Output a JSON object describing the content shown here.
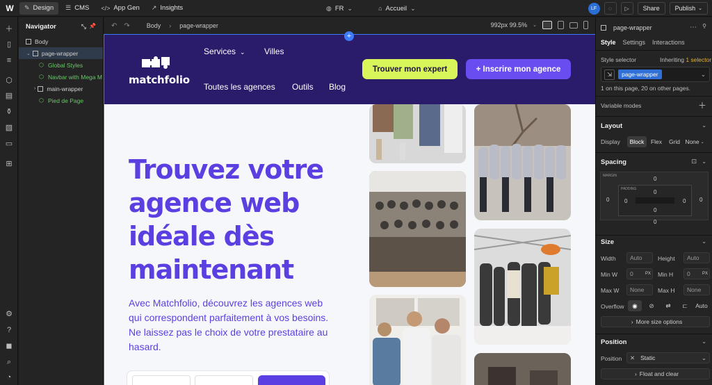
{
  "topbar": {
    "logo": "W",
    "modes": [
      {
        "label": "Design",
        "icon": "pencil-icon",
        "active": true
      },
      {
        "label": "CMS",
        "icon": "database-icon",
        "active": false
      },
      {
        "label": "App Gen",
        "icon": "code-icon",
        "active": false
      },
      {
        "label": "Insights",
        "icon": "chart-icon",
        "active": false
      }
    ],
    "locale": "FR",
    "page": "Accueil",
    "avatar": "LF",
    "share_label": "Share",
    "publish_label": "Publish"
  },
  "navigator": {
    "title": "Navigator",
    "tree": [
      {
        "label": "Body",
        "indent": 0,
        "kind": "box"
      },
      {
        "label": "page-wrapper",
        "indent": 1,
        "kind": "box",
        "selected": true
      },
      {
        "label": "Global Styles",
        "indent": 2,
        "kind": "component"
      },
      {
        "label": "Navbar with Mega M",
        "indent": 2,
        "kind": "component"
      },
      {
        "label": "main-wrapper",
        "indent": 2,
        "kind": "box"
      },
      {
        "label": "Pied de Page",
        "indent": 2,
        "kind": "component"
      }
    ]
  },
  "canvas_bar": {
    "breadcrumb": [
      "Body",
      "page-wrapper"
    ],
    "breakpoint": "992px 99.5%"
  },
  "site": {
    "brand": "matchfolio",
    "nav": {
      "services": "Services",
      "villes": "Villes",
      "agences": "Toutes les agences",
      "outils": "Outils",
      "blog": "Blog"
    },
    "cta_primary": "Trouver mon expert",
    "cta_secondary": "+ Inscrire mon agence",
    "hero_title": "Trouvez votre agence web idéale dès maintenant",
    "hero_text": "Avec Matchfolio, découvrez les agences web qui correspondent parfaitement à vos besoins. Ne laissez pas le choix de votre prestataire au hasard."
  },
  "panel": {
    "element": "page-wrapper",
    "tabs": [
      "Style",
      "Settings",
      "Interactions"
    ],
    "style_selector_label": "Style selector",
    "inheriting": "Inheriting",
    "inheriting_count": "1 selector",
    "selector_chip": "page-wrapper",
    "usage_note": "1 on this page, 20 on other pages.",
    "variable_modes": "Variable modes",
    "layout": {
      "title": "Layout",
      "display_label": "Display",
      "options": [
        "Block",
        "Flex",
        "Grid",
        "None"
      ]
    },
    "spacing": {
      "title": "Spacing",
      "margin_label": "MARGIN",
      "padding_label": "PADDING",
      "value": "0"
    },
    "size": {
      "title": "Size",
      "width": "Width",
      "height": "Height",
      "min_w": "Min W",
      "min_h": "Min H",
      "max_w": "Max W",
      "max_h": "Max H",
      "auto": "Auto",
      "none": "None",
      "zero": "0",
      "px": "PX",
      "overflow": "Overflow",
      "overflow_auto": "Auto",
      "more": "More size options"
    },
    "position": {
      "title": "Position",
      "label": "Position",
      "value": "Static",
      "float": "Float and clear"
    }
  }
}
